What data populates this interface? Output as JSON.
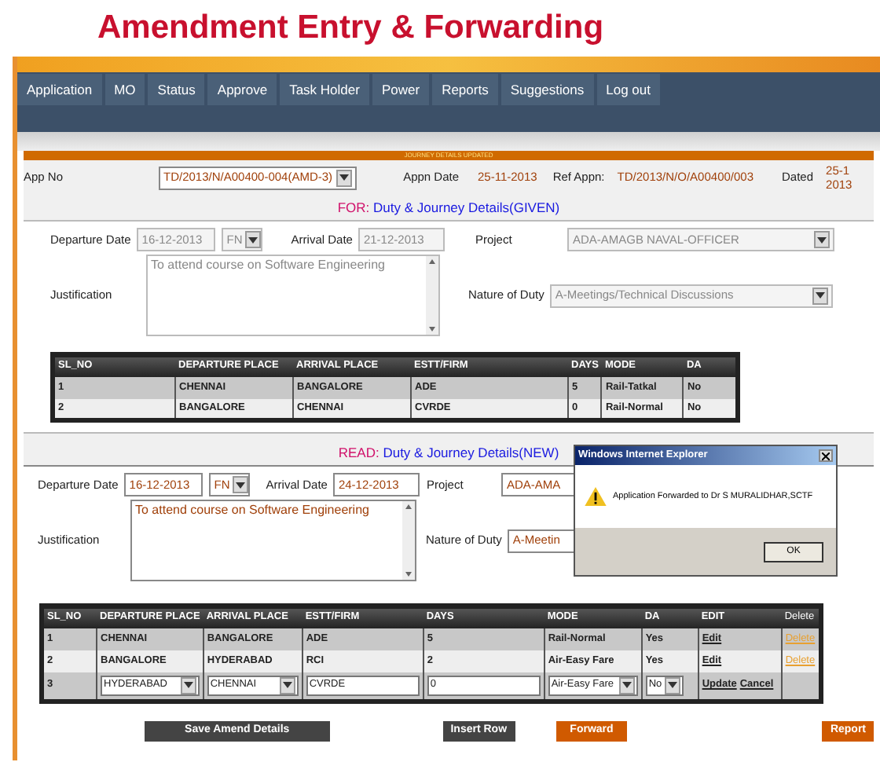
{
  "title": "Amendment Entry & Forwarding",
  "nav": [
    "Application",
    "MO",
    "Status",
    "Approve",
    "Task Holder",
    "Power",
    "Reports",
    "Suggestions",
    "Log out"
  ],
  "banner": "JOURNEY DETAILS UPDATED",
  "app": {
    "label": "App No",
    "value": "TD/2013/N/A00400-004(AMD-3)",
    "appn_date_label": "Appn Date",
    "appn_date": "25-11-2013",
    "ref_label": "Ref Appn:",
    "ref": "TD/2013/N/O/A00400/003",
    "dated_label": "Dated",
    "dated_lines": [
      "25-1",
      "2013"
    ]
  },
  "sections": [
    {
      "prefix": "FOR:",
      "heading": "Duty & Journey Details(GIVEN)",
      "disabled": true,
      "departure_label": "Departure Date",
      "departure": "16-12-2013",
      "session": "FN",
      "arrival_label": "Arrival Date",
      "arrival": "21-12-2013",
      "project_label": "Project",
      "project": "ADA-AMAGB NAVAL-OFFICER",
      "justification_label": "Justification",
      "justification": "To attend course on Software Engineering",
      "nature_label": "Nature of Duty",
      "nature": "A-Meetings/Technical Discussions",
      "table": {
        "columns": [
          "SL_NO",
          "DEPARTURE PLACE",
          "ARRIVAL PLACE",
          "ESTT/FIRM",
          "DAYS",
          "MODE",
          "DA"
        ],
        "rows": [
          {
            "kind": "view",
            "cells": [
              "1",
              "CHENNAI",
              "BANGALORE",
              "ADE",
              "5",
              "Rail-Tatkal",
              "No"
            ]
          },
          {
            "kind": "view",
            "cells": [
              "2",
              "BANGALORE",
              "CHENNAI",
              "CVRDE",
              "0",
              "Rail-Normal",
              "No"
            ]
          }
        ]
      }
    },
    {
      "prefix": "READ:",
      "heading": "Duty & Journey Details(NEW)",
      "disabled": false,
      "departure_label": "Departure Date",
      "departure": "16-12-2013",
      "session": "FN",
      "arrival_label": "Arrival Date",
      "arrival": "24-12-2013",
      "project_label": "Project",
      "project": "ADA-AMA",
      "justification_label": "Justification",
      "justification": "To attend course on Software Engineering",
      "nature_label": "Nature of Duty",
      "nature": "A-Meetin",
      "table": {
        "columns": [
          "SL_NO",
          "DEPARTURE PLACE",
          "ARRIVAL PLACE",
          "ESTT/FIRM",
          "DAYS",
          "MODE",
          "DA",
          "EDIT",
          "Delete"
        ],
        "rows": [
          {
            "kind": "view",
            "cells": [
              "1",
              "CHENNAI",
              "BANGALORE",
              "ADE",
              "5",
              "Rail-Normal",
              "Yes"
            ],
            "edit": "Edit",
            "delete": "Delete"
          },
          {
            "kind": "view",
            "cells": [
              "2",
              "BANGALORE",
              "HYDERABAD",
              "RCI",
              "2",
              "Air-Easy Fare",
              "Yes"
            ],
            "edit": "Edit",
            "delete": "Delete"
          },
          {
            "kind": "edit",
            "sl": "3",
            "fields": [
              {
                "kind": "select",
                "value": "HYDERABAD"
              },
              {
                "kind": "select",
                "value": "CHENNAI"
              },
              {
                "kind": "input",
                "value": "CVRDE"
              },
              {
                "kind": "input",
                "value": "0"
              },
              {
                "kind": "select",
                "value": "Air-Easy Fare"
              },
              {
                "kind": "select",
                "value": "No"
              }
            ],
            "actions": [
              "Update",
              "Cancel"
            ]
          }
        ]
      }
    }
  ],
  "buttons": [
    {
      "label": "Save Amend Details",
      "kind": "dark"
    },
    {
      "label": "Insert Row",
      "kind": "dark"
    },
    {
      "label": "Forward",
      "kind": "orange"
    },
    {
      "label": "Report",
      "kind": "orange"
    }
  ],
  "dialog": {
    "title": "Windows Internet Explorer",
    "message": "Application Forwarded to Dr S MURALIDHAR,SCTF",
    "button": "OK"
  }
}
